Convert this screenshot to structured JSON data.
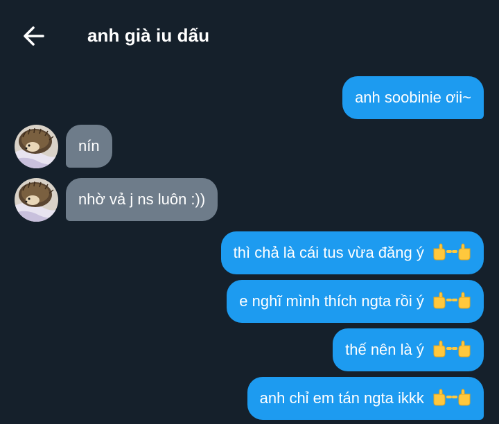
{
  "header": {
    "back_icon": "arrow-left-icon",
    "title": "anh già iu dấu"
  },
  "colors": {
    "background": "#15202b",
    "outgoing_bubble": "#1d9bf0",
    "incoming_bubble": "#6e7c8a",
    "text": "#ffffff"
  },
  "messages": [
    {
      "direction": "outgoing",
      "text": "anh soobinie ơii~"
    },
    {
      "direction": "incoming",
      "text": "nín",
      "avatar": "hedgehog-avatar"
    },
    {
      "direction": "incoming",
      "text": "nhờ vả j ns luôn :))",
      "avatar": "hedgehog-avatar"
    },
    {
      "direction": "outgoing",
      "text": "thì chả là cái tus vừa đăng ý",
      "emoji": "pointing-hands-emoji"
    },
    {
      "direction": "outgoing",
      "text": "e nghĩ mình thích ngta rồi ý",
      "emoji": "pointing-hands-emoji"
    },
    {
      "direction": "outgoing",
      "text": "thế nên là ý",
      "emoji": "pointing-hands-emoji"
    },
    {
      "direction": "outgoing",
      "text": "anh chỉ em tán ngta ikkk",
      "emoji": "pointing-hands-emoji"
    }
  ]
}
